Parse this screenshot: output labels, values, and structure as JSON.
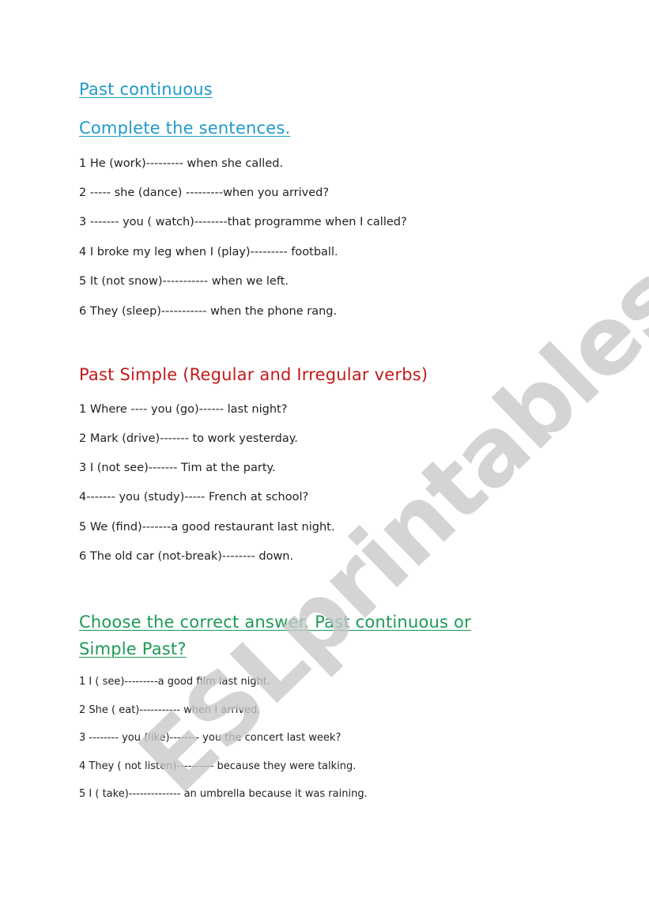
{
  "watermark": "ESLprintables.com",
  "colors": {
    "section1": "#1f9bc9",
    "section2": "#c41a1a",
    "section3": "#1d9a55",
    "watermark": "#c8c8c8"
  },
  "section1": {
    "title": "Past continuous",
    "instruction": "Complete the sentences.",
    "items": [
      "1 He (work)--------- when she called.",
      "2 ----- she (dance) ---------when you  arrived?",
      "3 ------- you ( watch)--------that programme when I called?",
      "4 I broke my leg when I (play)--------- football.",
      "5 It (not snow)----------- when we left.",
      "6 They  (sleep)----------- when the phone rang."
    ]
  },
  "section2": {
    "title": "Past Simple  (Regular and Irregular verbs)",
    "items": [
      "1 Where ---- you (go)------ last night?",
      "2 Mark (drive)------- to work yesterday.",
      "3 I (not see)------- Tim at the party.",
      "4------- you (study)----- French at school?",
      "5 We (find)-------a good restaurant last night.",
      "6 The old car (not-break)-------- down."
    ]
  },
  "section3": {
    "title_line1": "Choose the correct answer. Past continuous or",
    "title_line2": "Simple Past?",
    "items": [
      "1 I   ( see)---------a good film last night.",
      "2 She  ( eat)----------- when I arrived.",
      "3  -------- you (like)-------- you  the concert last week?",
      "4 They ( not listen)---------- because they were talking.",
      "5 I  ( take)-------------- an umbrella because it was raining."
    ]
  }
}
